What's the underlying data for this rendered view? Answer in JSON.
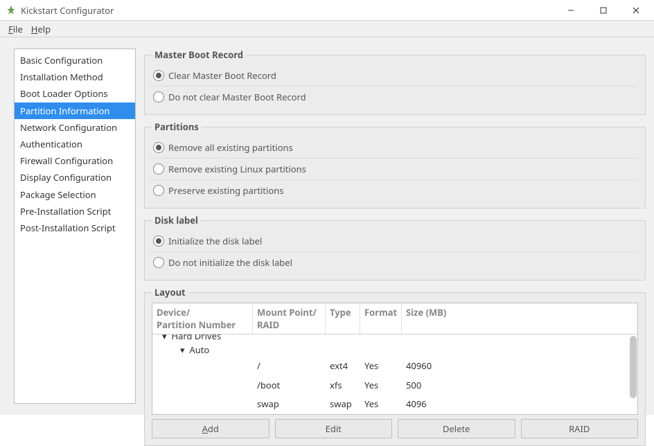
{
  "window": {
    "title": "Kickstart Configurator"
  },
  "menu": {
    "file": "File",
    "help": "Help"
  },
  "sidebar": {
    "items": [
      {
        "label": "Basic Configuration",
        "selected": false
      },
      {
        "label": "Installation Method",
        "selected": false
      },
      {
        "label": "Boot Loader Options",
        "selected": false
      },
      {
        "label": "Partition Information",
        "selected": true
      },
      {
        "label": "Network Configuration",
        "selected": false
      },
      {
        "label": "Authentication",
        "selected": false
      },
      {
        "label": "Firewall Configuration",
        "selected": false
      },
      {
        "label": "Display Configuration",
        "selected": false
      },
      {
        "label": "Package Selection",
        "selected": false
      },
      {
        "label": "Pre-Installation Script",
        "selected": false
      },
      {
        "label": "Post-Installation Script",
        "selected": false
      }
    ]
  },
  "mbr": {
    "legend": "Master Boot Record",
    "clear": "Clear Master Boot Record",
    "noclear": "Do not clear Master Boot Record",
    "selected": "clear"
  },
  "partitions_opt": {
    "legend": "Partitions",
    "remove_all": "Remove all existing partitions",
    "remove_linux": "Remove existing Linux partitions",
    "preserve": "Preserve existing partitions",
    "selected": "remove_all"
  },
  "disklabel": {
    "legend": "Disk label",
    "init": "Initialize the disk label",
    "noinit": "Do not initialize the disk label",
    "selected": "init"
  },
  "layout": {
    "legend": "Layout",
    "columns": {
      "dev": "Device/\nPartition Number",
      "mnt": "Mount Point/\nRAID",
      "type": "Type",
      "format": "Format",
      "size": "Size (MB)"
    },
    "tree": {
      "root_label": "Hard Drives",
      "auto_label": "Auto"
    },
    "rows": [
      {
        "mount": "/",
        "type": "ext4",
        "format": "Yes",
        "size": "40960"
      },
      {
        "mount": "/boot",
        "type": "xfs",
        "format": "Yes",
        "size": "500"
      },
      {
        "mount": "swap",
        "type": "swap",
        "format": "Yes",
        "size": "4096"
      }
    ],
    "buttons": {
      "add": "Add",
      "edit": "Edit",
      "delete": "Delete",
      "raid": "RAID"
    }
  }
}
